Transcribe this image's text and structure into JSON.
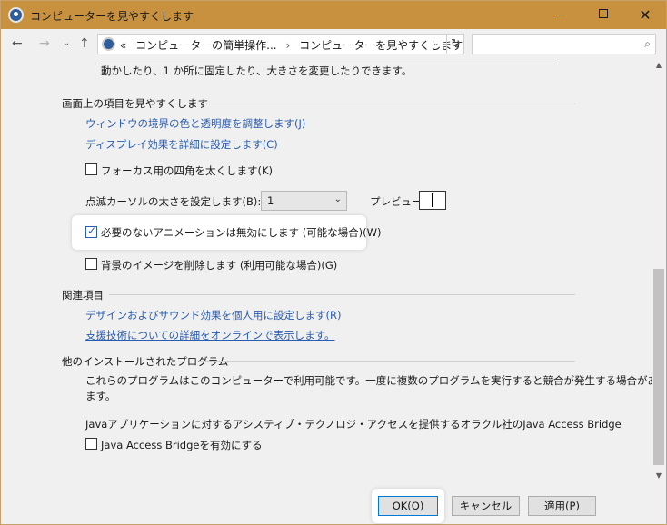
{
  "window": {
    "title": "コンピューターを見やすくします",
    "min_glyph": "—",
    "close_glyph": "✕"
  },
  "nav": {
    "back_glyph": "←",
    "forward_glyph": "→",
    "recent_glyph": "⌄",
    "up_glyph": "↑",
    "breadcrumb_prefix": "«",
    "breadcrumb_1": "コンピューターの簡単操作...",
    "breadcrumb_sep": "›",
    "breadcrumb_2": "コンピューターを見やすくします",
    "dropdown_glyph": "⌄",
    "refresh_glyph": "↻",
    "search_placeholder": "",
    "search_glyph": "⌕"
  },
  "content": {
    "partial_text": "動かしたり、1 か所に固定したり、大きさを変更したりできます。",
    "screen_items": {
      "heading": "画面上の項目を見やすくします",
      "link_border": "ウィンドウの境界の色と透明度を調整します(J)",
      "link_display": "ディスプレイ効果を詳細に設定します(C)",
      "focus_rect_label": "フォーカス用の四角を太くします(K)",
      "focus_rect_checked": false,
      "cursor_label": "点滅カーソルの太さを設定します(B):",
      "cursor_value": "1",
      "preview_label": "プレビュー:",
      "animation_label": "必要のないアニメーションは無効にします (可能な場合)(W)",
      "animation_checked": true,
      "background_label": "背景のイメージを削除します (利用可能な場合)(G)",
      "background_checked": false
    },
    "related": {
      "heading": "関連項目",
      "link_design": "デザインおよびサウンド効果を個人用に設定します(R)",
      "link_assistive": "支援技術についての詳細をオンラインで表示します。"
    },
    "other_programs": {
      "heading": "他のインストールされたプログラム",
      "desc_line1": "これらのプログラムはこのコンピューターで利用可能です。一度に複数のプログラムを実行すると競合が発生する場合があり",
      "desc_line2": "ます。",
      "java_desc": "Javaアプリケーションに対するアシスティブ・テクノロジ・アクセスを提供するオラクル社のJava Access Bridge",
      "java_label": "Java Access Bridgeを有効にする",
      "java_checked": false
    }
  },
  "scrollbar": {
    "up_glyph": "▲",
    "down_glyph": "▼"
  },
  "footer": {
    "ok": "OK(O)",
    "cancel": "キャンセル",
    "apply": "適用(P)"
  }
}
